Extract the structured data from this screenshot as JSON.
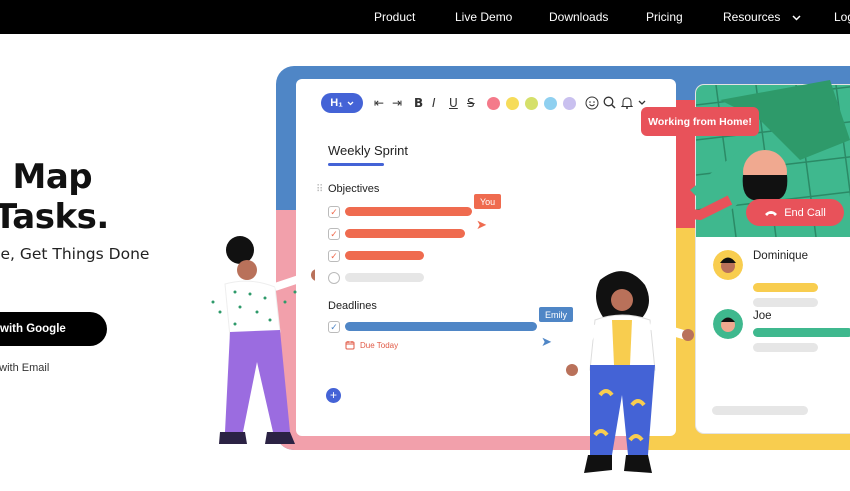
{
  "nav": {
    "items": [
      {
        "label": "Product"
      },
      {
        "label": "Live Demo"
      },
      {
        "label": "Downloads"
      },
      {
        "label": "Pricing"
      },
      {
        "label": "Resources"
      },
      {
        "label": "Log"
      }
    ]
  },
  "hero": {
    "title_line1": "l Map",
    "title_line2": "Tasks.",
    "subtitle": "ize, Get Things Done",
    "google_button": "with Google",
    "email_link": "o with Email"
  },
  "doc": {
    "heading_button": "H₁",
    "title": "Weekly Sprint",
    "objectives_label": "Objectives",
    "deadlines_label": "Deadlines",
    "you_tag": "You",
    "emily_tag": "Emily",
    "due_text": "Due Today",
    "add_symbol": "+"
  },
  "call": {
    "status_bubble": "Working from Home!",
    "end_call": "End Call",
    "participants": [
      {
        "name": "Dominique"
      },
      {
        "name": "Joe"
      }
    ]
  },
  "colors": {
    "accent_blue": "#4463d6",
    "frame_blue": "#4f86c6",
    "coral": "#ef6b4f",
    "red": "#e8525a",
    "yellow": "#f8cd4f",
    "green": "#3fb88e",
    "pink": "#f2a0ab"
  },
  "palette_dots": [
    "#f47a8a",
    "#f6dc5a",
    "#d5e06a",
    "#8fd0f0",
    "#c9c0ef"
  ]
}
